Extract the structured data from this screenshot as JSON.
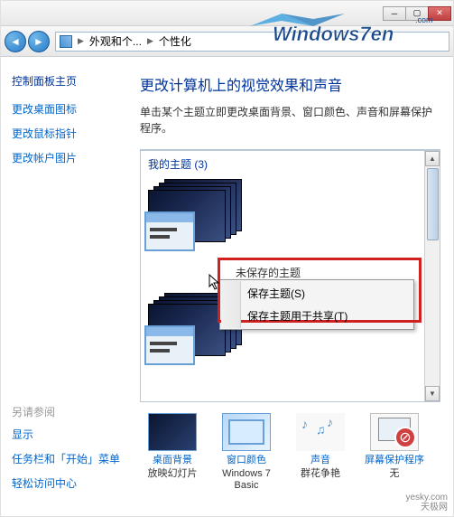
{
  "breadcrumb": {
    "item1": "外观和个...",
    "item2": "个性化"
  },
  "sidebar": {
    "title": "控制面板主页",
    "links": [
      "更改桌面图标",
      "更改鼠标指针",
      "更改帐户图片"
    ],
    "see_also_hdr": "另请参阅",
    "see_also": [
      "显示",
      "任务栏和「开始」菜单",
      "轻松访问中心"
    ]
  },
  "content": {
    "title": "更改计算机上的视觉效果和声音",
    "desc": "单击某个主题立即更改桌面背景、窗口颜色、声音和屏幕保护程序。",
    "themes_hdr": "我的主题 (3)",
    "hidden_label": "未保存的主题"
  },
  "context_menu": {
    "items": [
      "保存主题(S)",
      "保存主题用于共享(T)"
    ]
  },
  "bottom": {
    "items": [
      {
        "label": "桌面背景",
        "sub": "放映幻灯片"
      },
      {
        "label": "窗口颜色",
        "sub": "Windows 7 Basic"
      },
      {
        "label": "声音",
        "sub": "群花争艳"
      },
      {
        "label": "屏幕保护程序",
        "sub": "无"
      }
    ]
  },
  "watermark": {
    "brand": "Windows7en",
    "tld": ".com"
  },
  "yesky": {
    "line1": "yesky.com",
    "line2": "天极网"
  }
}
